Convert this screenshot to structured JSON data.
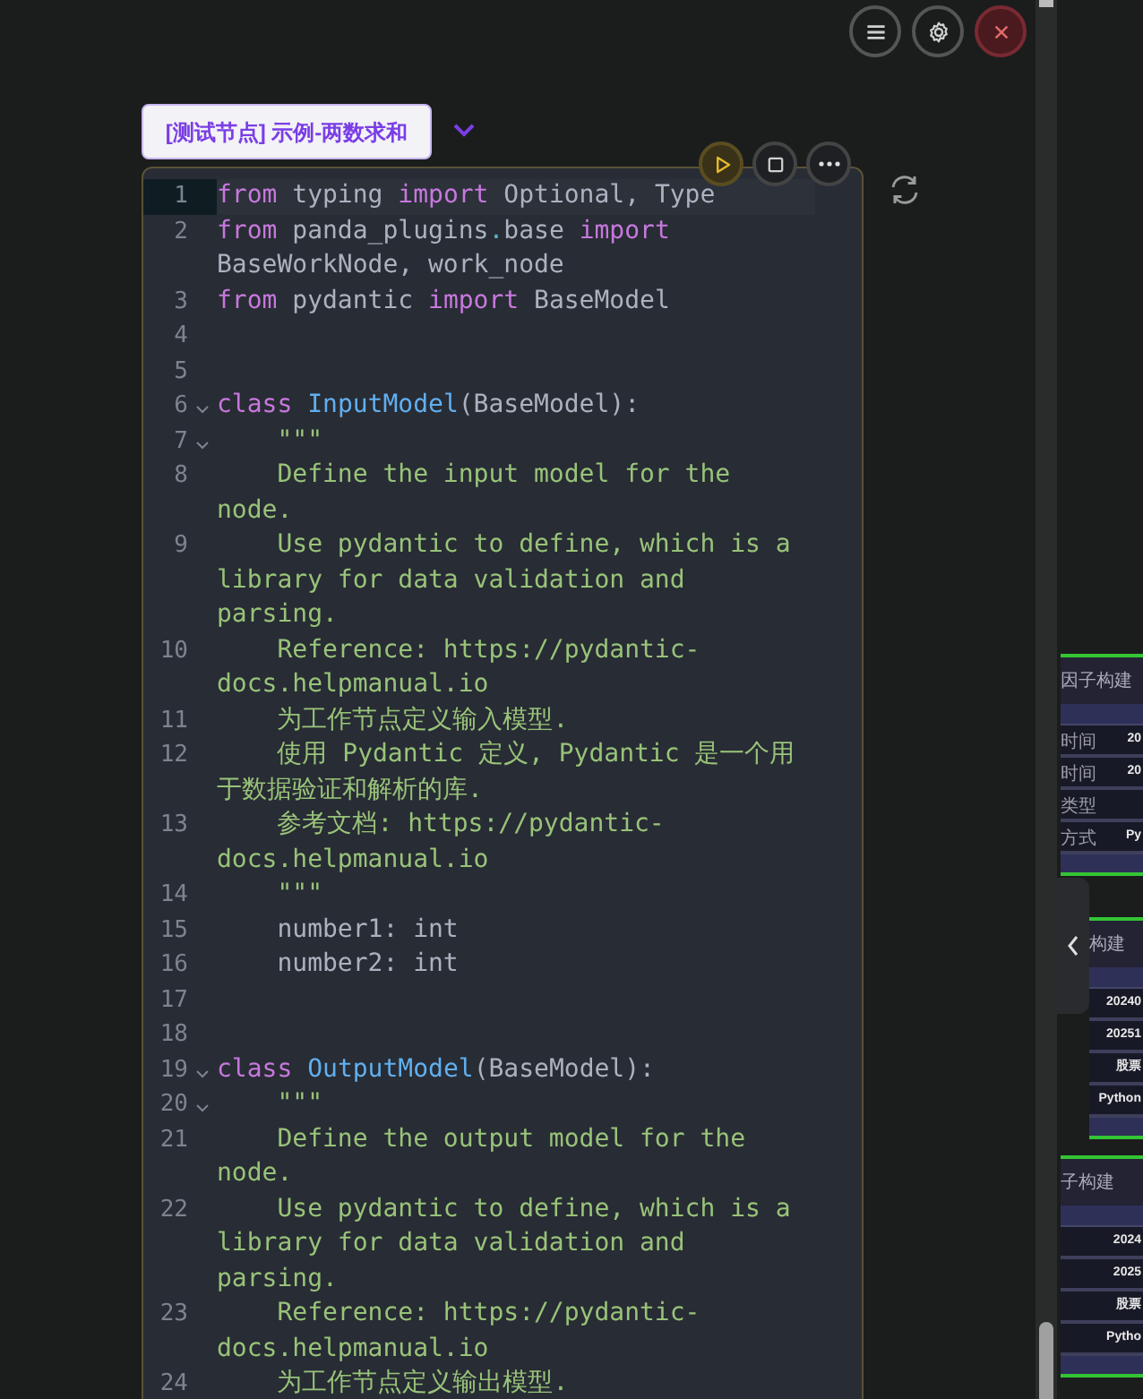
{
  "top_buttons": [
    {
      "kind": "menu"
    },
    {
      "kind": "settings"
    },
    {
      "kind": "close"
    }
  ],
  "node": {
    "title": "[测试节点] 示例-两数求和",
    "expanded": false,
    "actions": [
      {
        "kind": "run"
      },
      {
        "kind": "stop"
      },
      {
        "kind": "more"
      }
    ],
    "lines": [
      {
        "number": "1",
        "active": true,
        "tokens": [
          {
            "kind": "keyword",
            "text": "from"
          },
          {
            "kind": "plain",
            "text": " typing "
          },
          {
            "kind": "keyword",
            "text": "import"
          },
          {
            "kind": "plain",
            "text": " Optional, Type"
          }
        ]
      },
      {
        "number": "2",
        "active": false,
        "tokens": [
          {
            "kind": "keyword",
            "text": "from"
          },
          {
            "kind": "plain",
            "text": " panda_plugins"
          },
          {
            "kind": "operator",
            "text": "."
          },
          {
            "kind": "plain",
            "text": "base "
          },
          {
            "kind": "keyword",
            "text": "import"
          },
          {
            "kind": "plain",
            "text": " BaseWorkNode, work_node"
          }
        ]
      },
      {
        "number": "3",
        "active": false,
        "tokens": [
          {
            "kind": "keyword",
            "text": "from"
          },
          {
            "kind": "plain",
            "text": " pydantic "
          },
          {
            "kind": "keyword",
            "text": "import"
          },
          {
            "kind": "plain",
            "text": " BaseModel"
          }
        ]
      },
      {
        "number": "4",
        "active": false
      },
      {
        "number": "5",
        "active": false
      },
      {
        "number": "6",
        "active": false,
        "foldable": true,
        "tokens": [
          {
            "kind": "keyword",
            "text": "class"
          },
          {
            "kind": "name",
            "text": " InputModel"
          },
          {
            "kind": "plain",
            "text": "(BaseModel):"
          }
        ]
      },
      {
        "number": "7",
        "active": false,
        "foldable": true,
        "tokens": [
          {
            "kind": "string",
            "text": "    \"\"\""
          }
        ]
      },
      {
        "number": "8",
        "active": false,
        "tokens": [
          {
            "kind": "string",
            "text": "    Define the input model for the node."
          }
        ]
      },
      {
        "number": "9",
        "active": false,
        "tokens": [
          {
            "kind": "string",
            "text": "    Use pydantic to define, which is a library for data validation and parsing."
          }
        ]
      },
      {
        "number": "10",
        "active": false,
        "tokens": [
          {
            "kind": "string",
            "text": "    Reference: https://pydantic-docs.helpmanual.io"
          }
        ]
      },
      {
        "number": "11",
        "active": false,
        "tokens": [
          {
            "kind": "string",
            "text": "    为工作节点定义输入模型."
          }
        ]
      },
      {
        "number": "12",
        "active": false,
        "tokens": [
          {
            "kind": "string",
            "text": "    使用 Pydantic 定义, Pydantic 是一个用于数据验证和解析的库."
          }
        ]
      },
      {
        "number": "13",
        "active": false,
        "tokens": [
          {
            "kind": "string",
            "text": "    参考文档: https://pydantic-docs.helpmanual.io"
          }
        ]
      },
      {
        "number": "14",
        "active": false,
        "tokens": [
          {
            "kind": "string",
            "text": "    \"\"\""
          }
        ]
      },
      {
        "number": "15",
        "active": false,
        "tokens": [
          {
            "kind": "plain",
            "text": "    number1: int"
          }
        ]
      },
      {
        "number": "16",
        "active": false,
        "tokens": [
          {
            "kind": "plain",
            "text": "    number2: int"
          }
        ]
      },
      {
        "number": "17",
        "active": false
      },
      {
        "number": "18",
        "active": false
      },
      {
        "number": "19",
        "active": false,
        "foldable": true,
        "tokens": [
          {
            "kind": "keyword",
            "text": "class"
          },
          {
            "kind": "name",
            "text": " OutputModel"
          },
          {
            "kind": "plain",
            "text": "(BaseModel):"
          }
        ]
      },
      {
        "number": "20",
        "active": false,
        "foldable": true,
        "tokens": [
          {
            "kind": "string",
            "text": "    \"\"\""
          }
        ]
      },
      {
        "number": "21",
        "active": false,
        "tokens": [
          {
            "kind": "string",
            "text": "    Define the output model for the node."
          }
        ]
      },
      {
        "number": "22",
        "active": false,
        "tokens": [
          {
            "kind": "string",
            "text": "    Use pydantic to define, which is a library for data validation and parsing."
          }
        ]
      },
      {
        "number": "23",
        "active": false,
        "tokens": [
          {
            "kind": "string",
            "text": "    Reference: https://pydantic-docs.helpmanual.io"
          }
        ]
      },
      {
        "number": "24",
        "active": false,
        "tokens": [
          {
            "kind": "string",
            "text": "    为工作节点定义输出模型."
          }
        ]
      }
    ]
  },
  "side_nodes": [
    {
      "title": "因子构建",
      "rows": [
        {
          "label": "时间",
          "value": "20"
        },
        {
          "label": "时间",
          "value": "20"
        },
        {
          "label": "类型"
        },
        {
          "label": "方式",
          "value": "Py"
        }
      ]
    },
    {
      "title": "构建",
      "rows": [
        {
          "value": "20240"
        },
        {
          "value": "20251"
        },
        {
          "value": "股票"
        },
        {
          "value": "Python"
        }
      ]
    },
    {
      "title": "子构建",
      "rows": [
        {
          "value": "2024"
        },
        {
          "value": "2025"
        },
        {
          "value": "股票"
        },
        {
          "value": "Pytho"
        }
      ]
    }
  ]
}
